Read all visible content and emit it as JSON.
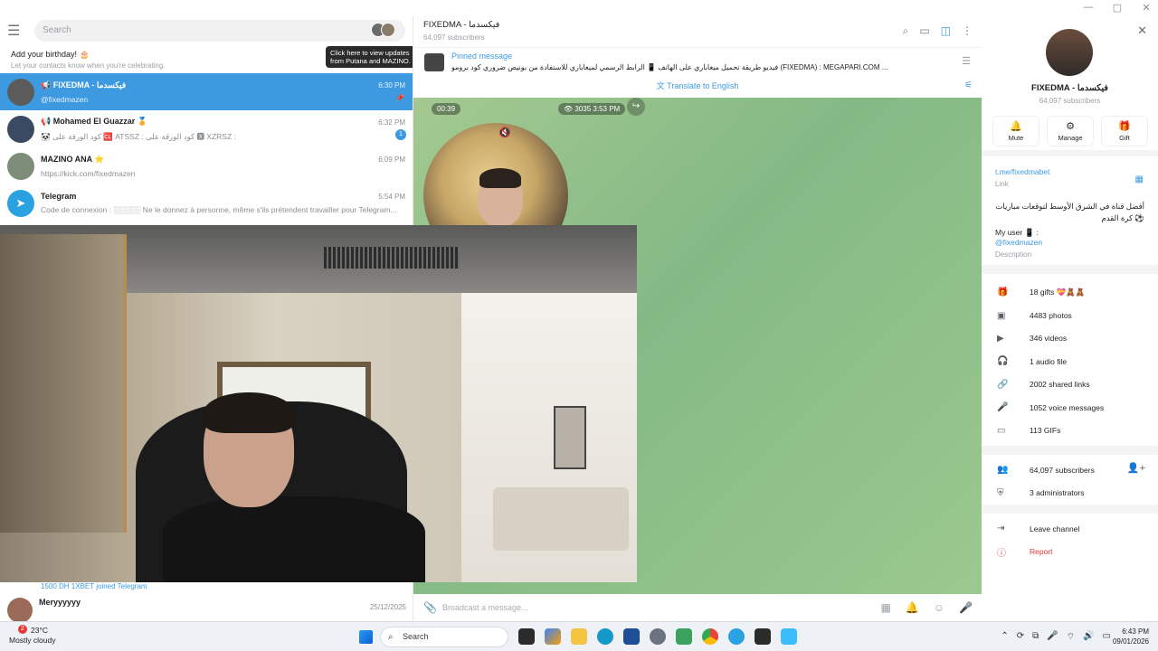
{
  "search": {
    "placeholder": "Search"
  },
  "birthday": {
    "title": "Add your birthday! 🎂",
    "subtitle": "Let your contacts know when you're celebrating."
  },
  "tooltip": {
    "line1": "Click here to view updates",
    "line2": "from Putana and MAZINO."
  },
  "chats": [
    {
      "name": "📢 FIXEDMA - فيكسدما",
      "preview": "@fixedmazen",
      "time": "6:30 PM",
      "active": true
    },
    {
      "name": "📢 Mohamed El Guazzar 🏅",
      "preview": "🐼 كود الورقة على 🆑 ATSSZ : كود الورقة على 🆇 XZRSZ :",
      "time": "6:32 PM",
      "badge": "1"
    },
    {
      "name": "MAZINO ANA ⭐",
      "preview": "https://kick.com/fixedmazen",
      "time": "6:09 PM"
    },
    {
      "name": "Telegram",
      "preview": "Code de connexion : ░░░░░ Ne le donnez à personne, même s'ils prétendent travailler pour Telegram...",
      "time": "5:54 PM"
    }
  ],
  "joined_text": "1500 DH 1XBET joined Telegram",
  "mery": {
    "name": "Meryyyyyy",
    "time": "25/12/2025"
  },
  "channel": {
    "title": "FIXEDMA - فيكسدما",
    "subscribers": "64,097 subscribers",
    "pinned_label": "Pinned message",
    "pinned_text": "فيديو طريقة تحميل ميغاباري على الهاتف 📱 الرابط الرسمي لميغابارِي للاستفادة من بونيص ضروري كود برومو (FIXEDMA) : MEGAPARI.COM ...",
    "translate": "Translate to English",
    "video_duration": "00:39",
    "views": "3035",
    "view_time": "3:53 PM",
    "composer_placeholder": "Broadcast a message..."
  },
  "info": {
    "name": "FIXEDMA - فيكسدما",
    "subscribers": "64,097 subscribers",
    "buttons": [
      "Mute",
      "Manage",
      "Gift"
    ],
    "link": "t.me/fixedmabet",
    "link_label": "Link",
    "description": "أفضل قناة في الشرق الأوسط لتوقعات مباريات كرة القدم ⚽",
    "user_label": "My user 📱 :",
    "user_handle": "@fixedmazen",
    "description_label": "Description",
    "stats": [
      "18 gifts 💝🧸🧸",
      "4483 photos",
      "346 videos",
      "1 audio file",
      "2002 shared links",
      "1052 voice messages",
      "113 GIFs"
    ],
    "subscribers_row": "64,097 subscribers",
    "admins": "3 administrators",
    "leave": "Leave channel",
    "report": "Report"
  },
  "taskbar": {
    "weather_temp": "23°C",
    "weather_desc": "Mostly cloudy",
    "weather_badge": "2",
    "search": "Search",
    "time": "6:43 PM",
    "date": "09/01/2026"
  }
}
